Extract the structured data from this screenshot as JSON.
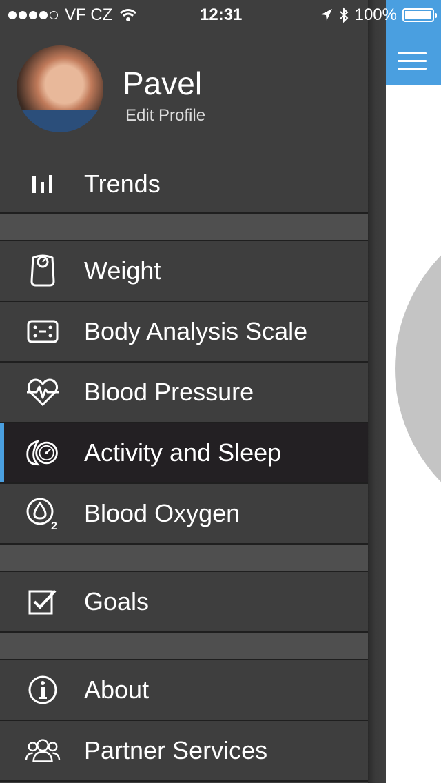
{
  "status_bar": {
    "carrier": "VF CZ",
    "time": "12:31",
    "battery": "100%",
    "signal_bars": 4
  },
  "profile": {
    "name": "Pavel",
    "edit_label": "Edit Profile"
  },
  "menu": {
    "trends": "Trends",
    "weight": "Weight",
    "body_analysis_scale": "Body Analysis Scale",
    "blood_pressure": "Blood Pressure",
    "activity_sleep": "Activity and Sleep",
    "blood_oxygen": "Blood Oxygen",
    "goals": "Goals",
    "about": "About",
    "partner_services": "Partner Services"
  },
  "colors": {
    "accent": "#4a9fe0",
    "drawer_bg": "#3e3e3e",
    "active_bg": "#232023",
    "separator_bg": "#4f4f4f"
  }
}
